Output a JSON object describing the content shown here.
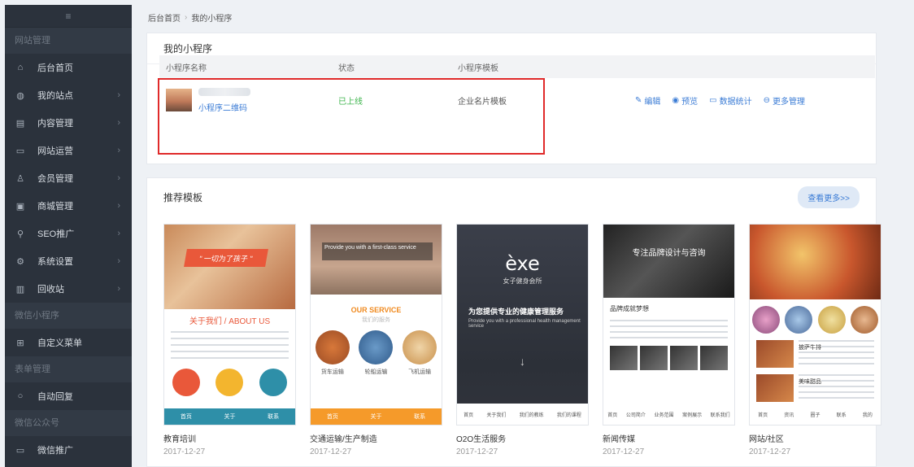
{
  "sidebar": {
    "top_label": "≡",
    "groups": {
      "site": "网站管理",
      "miniprogram": "微信小程序",
      "form": "表单管理",
      "official": "微信公众号"
    },
    "items": [
      {
        "label": "后台首页",
        "icon": "home-icon"
      },
      {
        "label": "我的站点",
        "icon": "globe-icon"
      },
      {
        "label": "内容管理",
        "icon": "document-icon"
      },
      {
        "label": "网站运营",
        "icon": "monitor-icon"
      },
      {
        "label": "会员管理",
        "icon": "users-icon"
      },
      {
        "label": "商城管理",
        "icon": "store-icon"
      },
      {
        "label": "SEO推广",
        "icon": "search-icon"
      },
      {
        "label": "系统设置",
        "icon": "gear-icon"
      },
      {
        "label": "回收站",
        "icon": "trash-icon"
      },
      {
        "label": "自定义菜单",
        "icon": "grid-icon"
      },
      {
        "label": "自动回复",
        "icon": "chat-icon"
      },
      {
        "label": "微信推广",
        "icon": "monitor-icon"
      }
    ]
  },
  "breadcrumb": {
    "home": "后台首页",
    "current": "我的小程序"
  },
  "my_mp": {
    "title": "我的小程序",
    "columns": [
      "小程序名称",
      "状态",
      "小程序模板"
    ],
    "row": {
      "name_link": "小程序二维码",
      "status": "已上线",
      "template": "企业名片模板",
      "actions": [
        {
          "label": "编辑",
          "icon": "edit-icon"
        },
        {
          "label": "预览",
          "icon": "eye-icon"
        },
        {
          "label": "数据统计",
          "icon": "chart-icon"
        },
        {
          "label": "更多管理",
          "icon": "more-icon"
        }
      ]
    }
  },
  "recommended": {
    "title": "推荐模板",
    "more_label": "查看更多>>",
    "templates": [
      {
        "name": "教育培训",
        "date": "2017-12-27",
        "banner": "\" 一切为了孩子 \"",
        "about": "关于我们 / ABOUT US",
        "nav": [
          "首页",
          "关于",
          "联系"
        ]
      },
      {
        "name": "交通运输/生产制造",
        "date": "2017-12-27",
        "caption": "Provide you with a first-class service",
        "service": "OUR SERVICE",
        "service_sub": "我们的服务",
        "labels": [
          "货车运输",
          "轮船运输",
          "飞机运输"
        ],
        "nav": [
          "首页",
          "关于",
          "联系"
        ]
      },
      {
        "name": "O2O生活服务",
        "date": "2017-12-27",
        "logo": "èxe",
        "logo_sub": "女子健身会所",
        "headline": "为您提供专业的健康管理服务",
        "headline_en": "Provide you with a professional health management service",
        "nav": [
          "首页",
          "关于我们",
          "我们的教练",
          "我们的课程"
        ]
      },
      {
        "name": "新闻传媒",
        "date": "2017-12-27",
        "hero": "专注品牌设计与咨询",
        "heading": "品牌成就梦想",
        "nav": [
          "首页",
          "公司简介",
          "业务范围",
          "案例展示",
          "联系我们"
        ]
      },
      {
        "name": "网站/社区",
        "date": "2017-12-27",
        "item_title": "披萨牛排",
        "item_title2": "美味甜品",
        "nav": [
          "首页",
          "资讯",
          "圈子",
          "联系",
          "我的"
        ]
      }
    ]
  },
  "colors": {
    "sidebar_bg": "#2b323c",
    "accent": "#3a7bd5",
    "status_online": "#3cb44b",
    "highlight_border": "#e02a2a"
  }
}
